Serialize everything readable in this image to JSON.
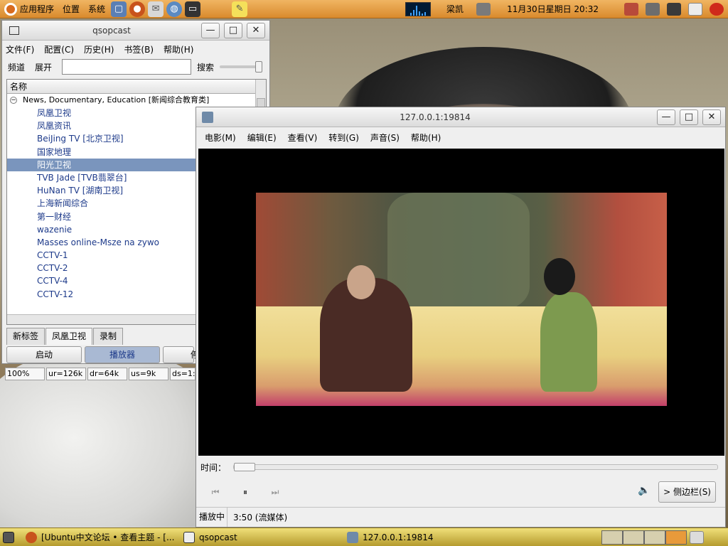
{
  "top_panel": {
    "menus": [
      "应用程序",
      "位置",
      "系统"
    ],
    "user": "梁凯",
    "clock": "11月30日星期日 20:32",
    "colors": {
      "panel": "#e09a3e"
    }
  },
  "qsopcast": {
    "title": "qsopcast",
    "menus": [
      "文件(F)",
      "配置(C)",
      "历史(H)",
      "书签(B)",
      "帮助(H)"
    ],
    "toolbar": {
      "channel_label": "频道",
      "expand_label": "展开",
      "search_label": "搜索",
      "search_value": ""
    },
    "tree": {
      "header": "名称",
      "group": "News, Documentary, Education [新闻综合教育类]",
      "items": [
        "凤凰卫视",
        "凤凰资讯",
        "BeiJing TV [北京卫视]",
        "国家地理",
        "阳光卫视",
        "TVB Jade [TVB翡翠台]",
        "HuNan TV [湖南卫视]",
        "上海新闻综合",
        "第一财经",
        "wazenie",
        "Masses online-Msze na zywo",
        "CCTV-1",
        "CCTV-2",
        "CCTV-4",
        "CCTV-12"
      ],
      "selected_index": 4
    },
    "tabs": [
      "新标签",
      "凤凰卫视",
      "录制"
    ],
    "buttons": {
      "start": "启动",
      "player": "播放器",
      "stop": "停"
    },
    "status": {
      "progress": "100%",
      "ur": "ur=126k",
      "dr": "dr=64k",
      "us": "us=9k",
      "ds": "ds=1:"
    }
  },
  "player": {
    "title": "127.0.0.1:19814",
    "menus": [
      "电影(M)",
      "编辑(E)",
      "查看(V)",
      "转到(G)",
      "声音(S)",
      "帮助(H)"
    ],
    "time_label": "时间：",
    "sidebar_label": "> 侧边栏(S)",
    "status_state": "播放中",
    "status_time": "3:50 (流媒体)",
    "seek_fraction": 0.0
  },
  "taskbar": {
    "tasks": [
      "[Ubuntu中文论坛 • 查看主题 - [...",
      "qsopcast",
      "127.0.0.1:19814"
    ]
  }
}
